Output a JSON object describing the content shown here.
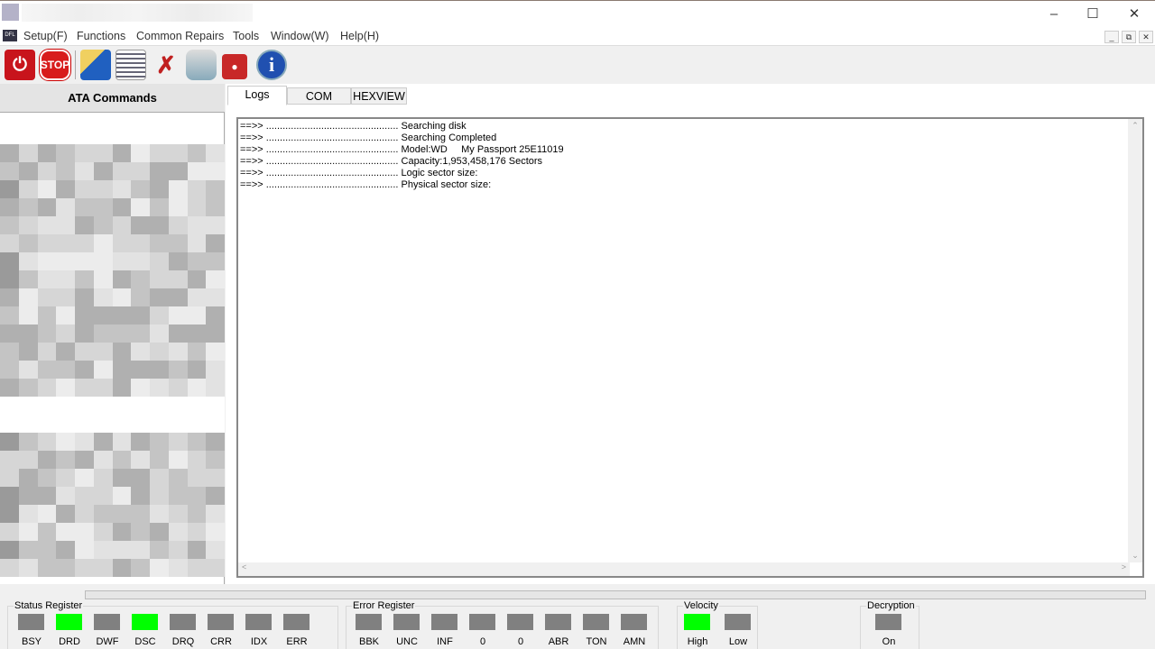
{
  "menu": [
    "Setup(F)",
    "Functions",
    "Common Repairs",
    "Tools",
    "Window(W)",
    "Help(H)"
  ],
  "toolbar": {
    "stop_label": "STOP"
  },
  "left_panel": {
    "title": "ATA Commands"
  },
  "tabs": [
    "Logs",
    "COM",
    "HEXVIEW"
  ],
  "log": [
    "==>> ................................................ Searching disk",
    "==>> ................................................ Searching Completed",
    "==>> ................................................ Model:WD     My Passport 25E11019",
    "==>> ................................................ Capacity:1,953,458,176 Sectors",
    "==>> ................................................ Logic sector size:",
    "==>> ................................................ Physical sector size:"
  ],
  "status_register": {
    "title": "Status Register",
    "leds": [
      {
        "label": "BSY",
        "on": false
      },
      {
        "label": "DRD",
        "on": true
      },
      {
        "label": "DWF",
        "on": false
      },
      {
        "label": "DSC",
        "on": true
      },
      {
        "label": "DRQ",
        "on": false
      },
      {
        "label": "CRR",
        "on": false
      },
      {
        "label": "IDX",
        "on": false
      },
      {
        "label": "ERR",
        "on": false
      }
    ]
  },
  "error_register": {
    "title": "Error Register",
    "leds": [
      {
        "label": "BBK",
        "on": false
      },
      {
        "label": "UNC",
        "on": false
      },
      {
        "label": "INF",
        "on": false
      },
      {
        "label": "0",
        "on": false
      },
      {
        "label": "0",
        "on": false
      },
      {
        "label": "ABR",
        "on": false
      },
      {
        "label": "TON",
        "on": false
      },
      {
        "label": "AMN",
        "on": false
      }
    ]
  },
  "velocity": {
    "title": "Velocity",
    "leds": [
      {
        "label": "High",
        "on": true
      },
      {
        "label": "Low",
        "on": false
      }
    ]
  },
  "decryption": {
    "title": "Decryption",
    "leds": [
      {
        "label": "On",
        "on": false
      }
    ]
  },
  "colors": {
    "led_on": "#00ff00",
    "led_off": "#808080"
  }
}
